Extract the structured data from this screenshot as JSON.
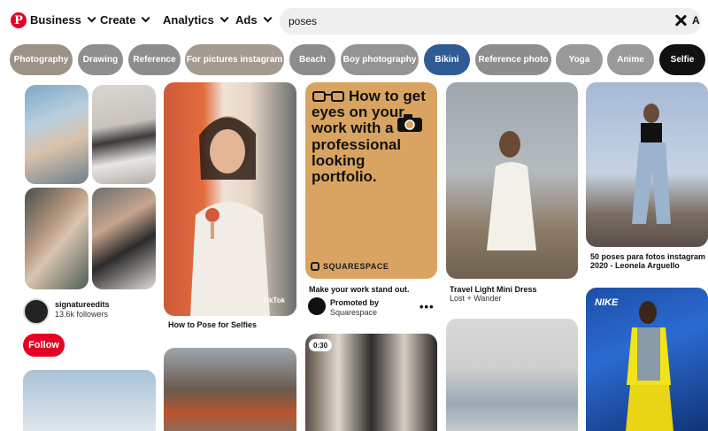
{
  "header": {
    "logo_letter": "P",
    "nav": [
      {
        "label": "Business"
      },
      {
        "label": "Create"
      },
      {
        "label": "Analytics"
      },
      {
        "label": "Ads"
      }
    ],
    "search": {
      "value": "poses",
      "trailing_truncated": "A"
    }
  },
  "chips": [
    {
      "label": "Photography",
      "color": "#9c9286"
    },
    {
      "label": "Drawing",
      "color": "#8f8f8f"
    },
    {
      "label": "Reference",
      "color": "#8d8d8d"
    },
    {
      "label": "For pictures instagram",
      "color": "#a49b90"
    },
    {
      "label": "Beach",
      "color": "#8d8d8d"
    },
    {
      "label": "Boy photography",
      "color": "#949494"
    },
    {
      "label": "Bikini",
      "color": "#2f5c97"
    },
    {
      "label": "Reference photo",
      "color": "#8e8e8e"
    },
    {
      "label": "Yoga",
      "color": "#9a9a9a"
    },
    {
      "label": "Anime",
      "color": "#9a9a9a"
    },
    {
      "label": "Selfie",
      "color": "#111111"
    }
  ],
  "pins": {
    "profile": {
      "name": "signatureedits",
      "followers": "13.6k followers",
      "follow_label": "Follow"
    },
    "selfie_pin": {
      "title": "How to Pose for Selfies",
      "watermark": "TikTok"
    },
    "ad_pin": {
      "headline": "How to get eyes on your work with a professional looking portfolio.",
      "brand": "SQUARESPACE",
      "title": "Make your work stand out.",
      "promoted_label": "Promoted by",
      "promoter": "Squarespace",
      "more": "•••"
    },
    "dress_pin": {
      "title": "Travel Light Mini Dress",
      "source": "Lost + Wander"
    },
    "poses_pin": {
      "title_line1": "50 poses para fotos instagram",
      "title_line2": "2020 - Leonela Arguello"
    },
    "video_pin": {
      "duration": "0:30"
    },
    "nike_pin": {
      "logo_text": "NIKE"
    }
  }
}
